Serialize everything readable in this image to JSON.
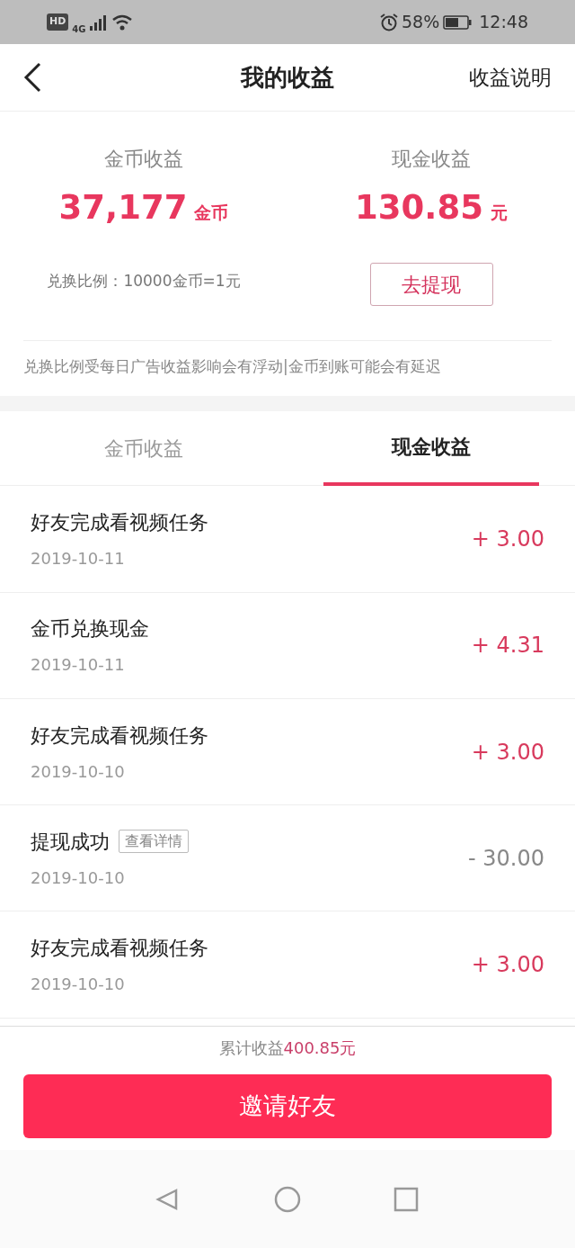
{
  "status_bar": {
    "hd": "HD",
    "network": "4G",
    "battery": "58%",
    "time": "12:48"
  },
  "header": {
    "title": "我的收益",
    "action": "收益说明"
  },
  "summary": {
    "coins": {
      "label": "金币收益",
      "value": "37,177",
      "unit": "金币"
    },
    "cash": {
      "label": "现金收益",
      "value": "130.85",
      "unit": "元"
    },
    "ratio": "兑换比例：10000金币=1元",
    "withdraw_button": "去提现",
    "notice": "兑换比例受每日广告收益影响会有浮动|金币到账可能会有延迟"
  },
  "tabs": [
    {
      "label": "金币收益",
      "selected": false
    },
    {
      "label": "现金收益",
      "selected": true
    }
  ],
  "records": [
    {
      "title": "好友完成看视频任务",
      "date": "2019-10-11",
      "amount": "+ 3.00",
      "kind": "income"
    },
    {
      "title": "金币兑换现金",
      "date": "2019-10-11",
      "amount": "+ 4.31",
      "kind": "income"
    },
    {
      "title": "好友完成看视频任务",
      "date": "2019-10-10",
      "amount": "+ 3.00",
      "kind": "income"
    },
    {
      "title": "提现成功",
      "detail_link": "查看详情",
      "date": "2019-10-10",
      "amount": "- 30.00",
      "kind": "expense"
    },
    {
      "title": "好友完成看视频任务",
      "date": "2019-10-10",
      "amount": "+ 3.00",
      "kind": "income"
    }
  ],
  "footer": {
    "total_label": "累计收益",
    "total_value": "400.85元",
    "invite_button": "邀请好友"
  }
}
